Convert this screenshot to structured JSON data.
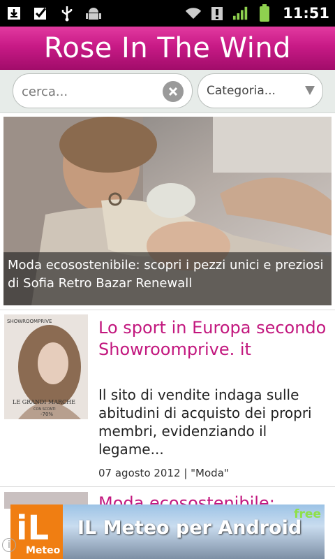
{
  "status_bar": {
    "time": "11:51"
  },
  "header": {
    "title": "Rose In The Wind"
  },
  "search": {
    "placeholder": "cerca...",
    "category_label": "Categoria..."
  },
  "feature": {
    "caption": "Moda ecosostenibile: scopri i pezzi unici e preziosi di Sofia Retro Bazar Renewall"
  },
  "articles": [
    {
      "title": "Lo sport in Europa secondo Showroomprive. it",
      "excerpt": "Il sito di vendite indaga sulle abitudini di acquisto dei propri membri, evidenziando il legame...",
      "meta": "07 agosto 2012 | \"Moda\"",
      "thumb_text_top": "SHOWROOMPRIVE",
      "thumb_text_mid": "LE GRANDI MARCHE",
      "thumb_text_small": "CON SCONTI",
      "thumb_text_pct": "-70%"
    },
    {
      "title": "Moda ecosostenibile:"
    }
  ],
  "ad": {
    "title": "IL Meteo per Android",
    "free_badge": "free",
    "logo_big": "iL",
    "logo_small": "Meteo"
  },
  "colors": {
    "brand": "#c2177e",
    "header_top": "#e23aa0",
    "header_bottom": "#a10c6a"
  }
}
